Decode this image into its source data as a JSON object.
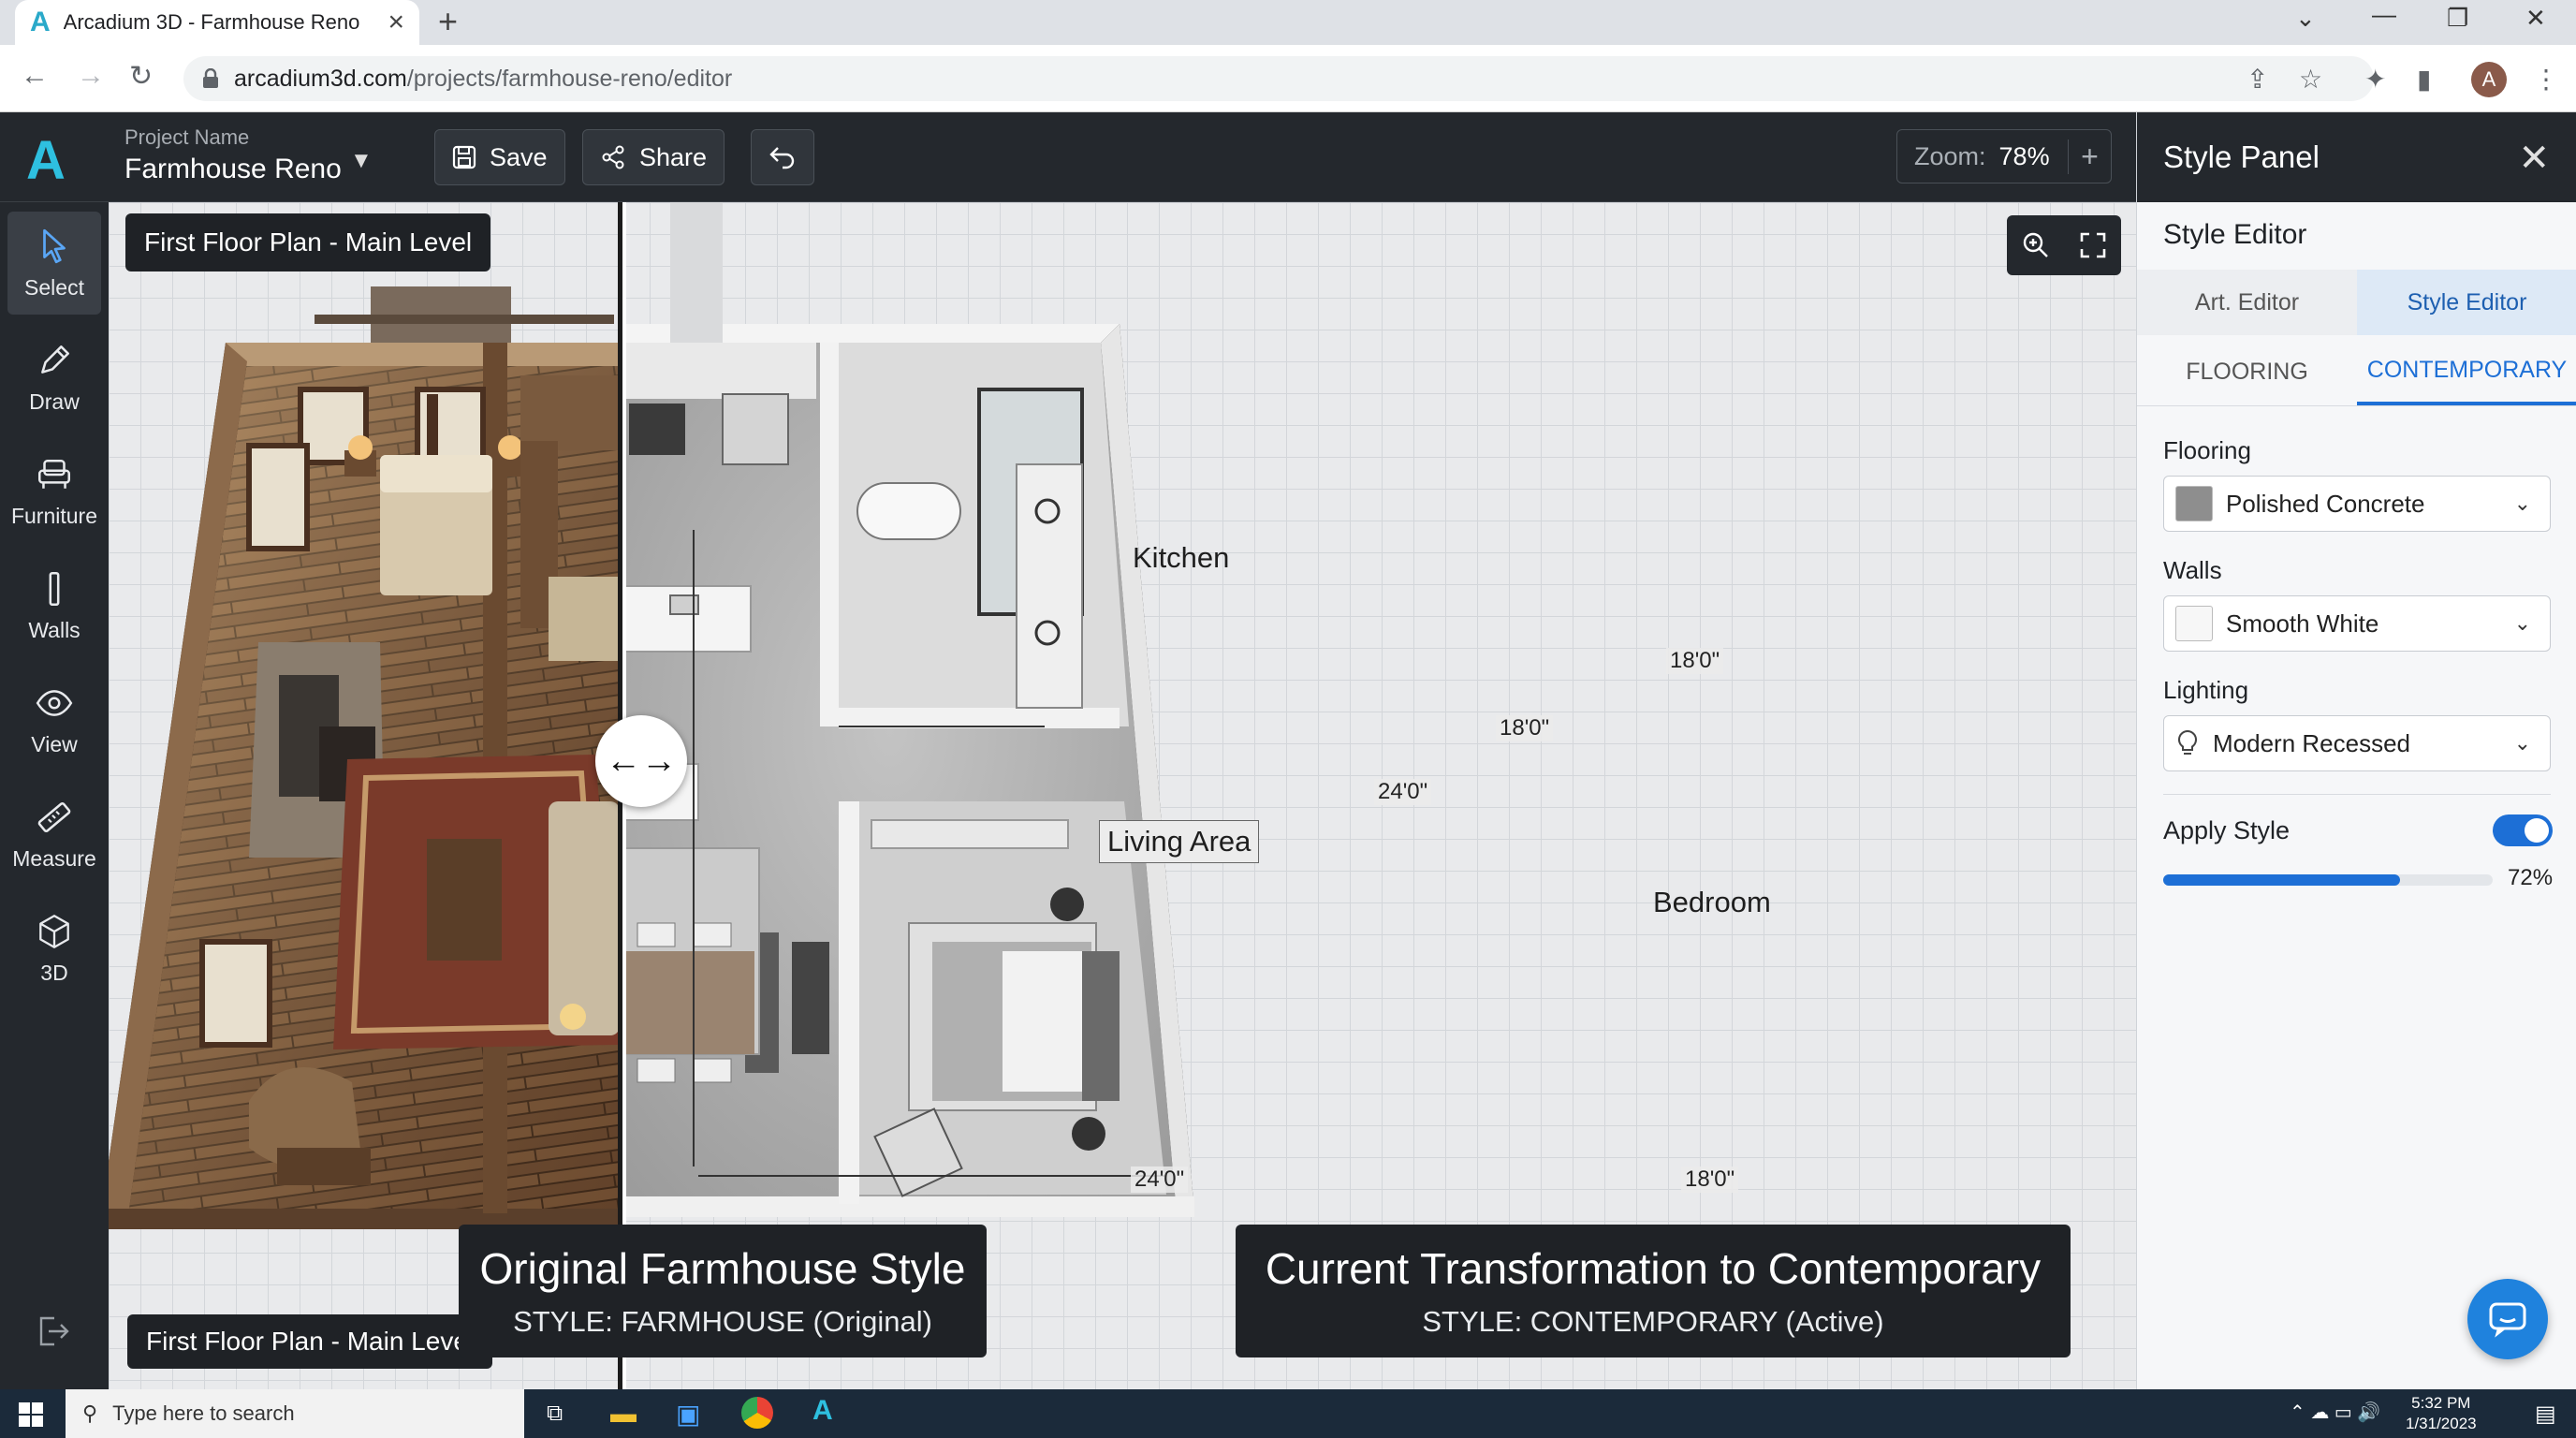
{
  "browser": {
    "tab_title": "Arcadium 3D - Farmhouse Reno",
    "tab_logo": "A",
    "url_host": "arcadium3d.com",
    "url_path": "/projects/farmhouse-reno/editor",
    "profile_initial": "A"
  },
  "app": {
    "logo": "A",
    "project_label": "Project Name",
    "project_name": "Farmhouse Reno",
    "save_label": "Save",
    "share_label": "Share",
    "zoom_label": "Zoom:",
    "zoom_value": "78%",
    "zoom_plus": "+"
  },
  "tools": [
    {
      "label": "Select",
      "icon": "cursor-icon"
    },
    {
      "label": "Draw",
      "icon": "pencil-icon"
    },
    {
      "label": "Furniture",
      "icon": "armchair-icon"
    },
    {
      "label": "Walls",
      "icon": "wall-icon"
    },
    {
      "label": "View",
      "icon": "eye-icon"
    },
    {
      "label": "Measure",
      "icon": "ruler-icon"
    },
    {
      "label": "3D",
      "icon": "cube-icon"
    }
  ],
  "canvas": {
    "floor_label_top": "First Floor Plan - Main Level",
    "floor_label_bottom": "First Floor Plan - Main Level",
    "left_caption_title": "Original Farmhouse Style",
    "left_caption_sub": "STYLE: FARMHOUSE (Original)",
    "right_caption_title": "Current Transformation to Contemporary",
    "right_caption_sub": "STYLE: CONTEMPORARY (Active)",
    "rooms": {
      "kitchen": "Kitchen",
      "living": "Living Area",
      "bedroom": "Bedroom"
    },
    "dims": {
      "d1": "18'0\"",
      "d2": "18'0\"",
      "d3": "24'0\"",
      "d4": "24'0\"",
      "d5": "18'0\""
    }
  },
  "style_panel": {
    "header": "Style Panel",
    "title": "Style Editor",
    "tab_a": "Art. Editor",
    "tab_b": "Style Editor",
    "sub_tab_a": "FLOORING",
    "sub_tab_b": "CONTEMPORARY",
    "flooring_label": "Flooring",
    "flooring_value": "Polished Concrete",
    "walls_label": "Walls",
    "walls_value": "Smooth White",
    "lighting_label": "Lighting",
    "lighting_value": "Modern Recessed",
    "apply_label": "Apply Style",
    "apply_enabled": true,
    "apply_strength": 0.72,
    "apply_pct": "72%"
  },
  "taskbar": {
    "search_placeholder": "Type here to search",
    "time": "5:32 PM",
    "date": "1/31/2023"
  },
  "colors": {
    "accent": "#1d6fd6",
    "brand": "#2ec0e0",
    "dark": "#24282d"
  }
}
